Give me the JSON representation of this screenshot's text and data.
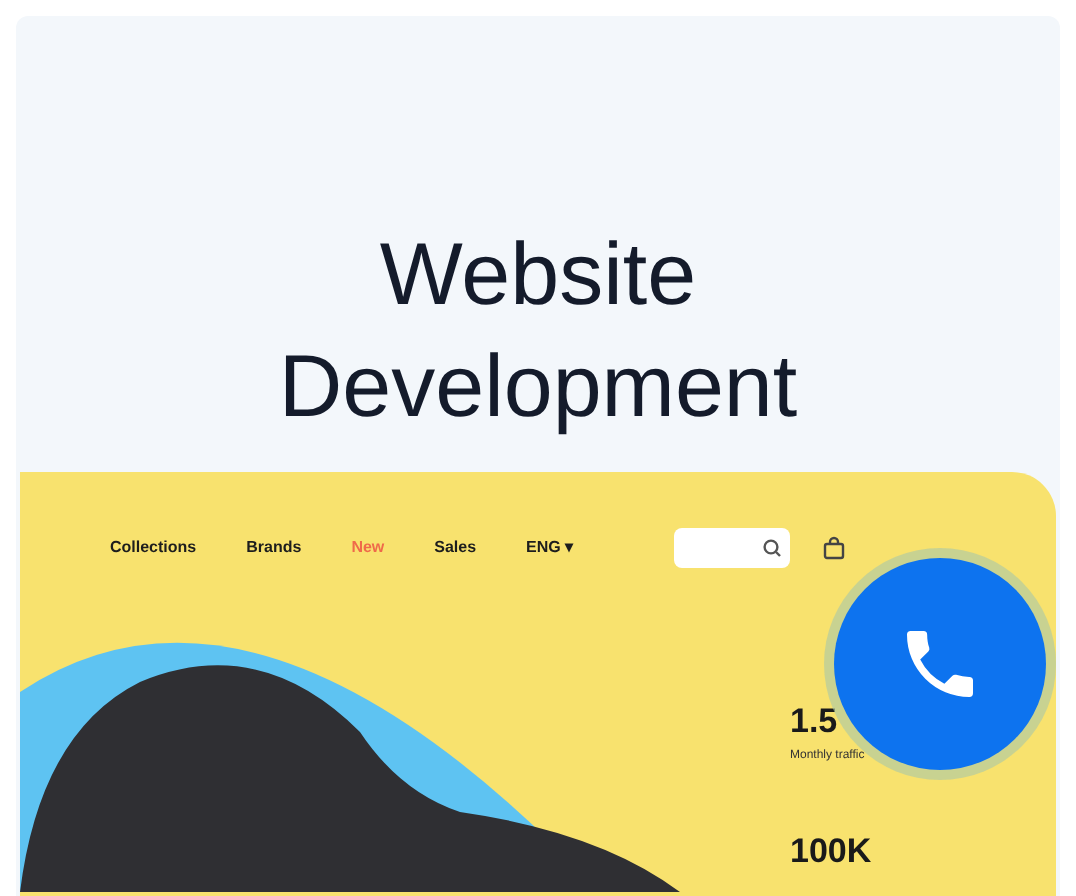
{
  "title": "Website Development",
  "mockup": {
    "nav": [
      {
        "label": "Collections",
        "selected": false
      },
      {
        "label": "Brands",
        "selected": false
      },
      {
        "label": "New",
        "selected": true
      },
      {
        "label": "Sales",
        "selected": false
      },
      {
        "label": "ENG ▾",
        "selected": false
      }
    ],
    "stats": [
      {
        "value": "1.5",
        "caption": "Monthly traffic"
      },
      {
        "value": "100K"
      }
    ]
  }
}
